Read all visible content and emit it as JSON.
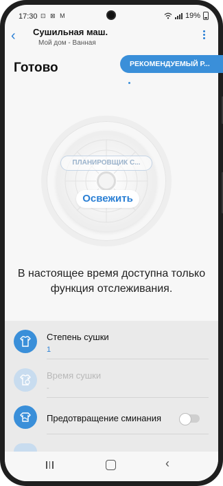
{
  "status_bar": {
    "time": "17:30",
    "left_icons": "⊡ ⊠ M",
    "battery": "19%"
  },
  "header": {
    "title": "Сушильная маш.",
    "subtitle": "Мой дом - Ванная"
  },
  "device": {
    "state": "Готово",
    "recommended_label": "РЕКОМЕНДУЕМЫЙ Р...",
    "planner_label": "ПЛАНИРОВЩИК С...",
    "refresh_label": "Освежить"
  },
  "info_message": "В настоящее время доступна только функция отслеживания.",
  "settings": [
    {
      "label": "Степень сушки",
      "value": "1",
      "icon": "shirt-icon",
      "enabled": true
    },
    {
      "label": "Время сушки",
      "value": "-",
      "icon": "timer-shirt-icon",
      "enabled": false
    },
    {
      "label": "Предотвращение сминания",
      "value": "",
      "icon": "wrinkle-prevention-icon",
      "toggle": false,
      "enabled": true
    }
  ],
  "colors": {
    "accent": "#2a7fd4",
    "pill": "#3a8fd9"
  }
}
